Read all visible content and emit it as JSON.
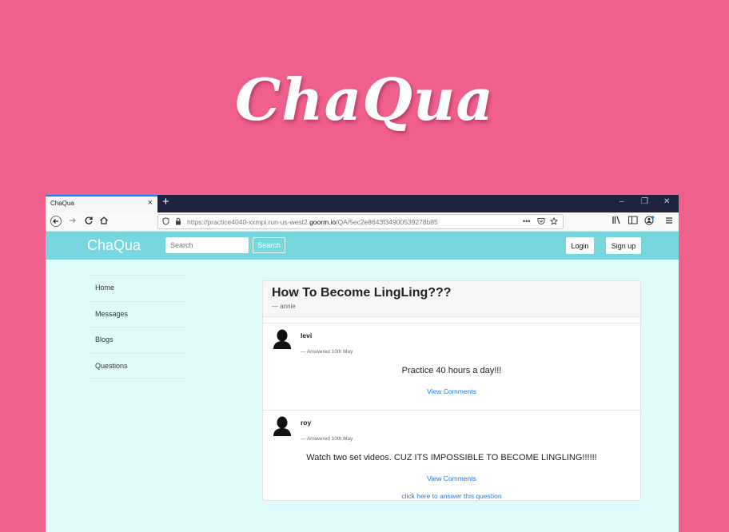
{
  "hero": {
    "title": "ChaQua"
  },
  "browser": {
    "tab_title": "ChaQua",
    "tab_close": "×",
    "new_tab": "+",
    "win_min": "–",
    "win_restore": "❐",
    "win_close": "✕",
    "url_prefix": "https://practice4040-xxmpi.run-us-west2.",
    "url_host": "goorm.io",
    "url_path": "/QA/5ec2e8643f34900539278b85",
    "url_more": "•••"
  },
  "site": {
    "brand": "ChaQua",
    "search_placeholder": "Search",
    "search_button": "Search",
    "login": "Login",
    "signup": "Sign up"
  },
  "sidebar": {
    "items": [
      {
        "label": "Home"
      },
      {
        "label": "Messages"
      },
      {
        "label": "Blogs"
      },
      {
        "label": "Questions"
      }
    ]
  },
  "question": {
    "title": "How To Become LingLing???",
    "author": "— annie",
    "answers": [
      {
        "user": "levi",
        "date": "— Answered 10th May",
        "text": "Practice 40 hours a day!!!",
        "link": "View Comments"
      },
      {
        "user": "roy",
        "date": "— Answered 10th May",
        "text": "Watch two set videos. CUZ ITS IMPOSSIBLE TO BECOME LINGLING!!!!!!",
        "link": "View Comments"
      }
    ],
    "answer_link": "click here to answer this question"
  },
  "colors": {
    "background": "#f0608c",
    "site_header": "#78d6de",
    "page_bg": "#e0fbfc",
    "link": "#1a7fe6"
  }
}
